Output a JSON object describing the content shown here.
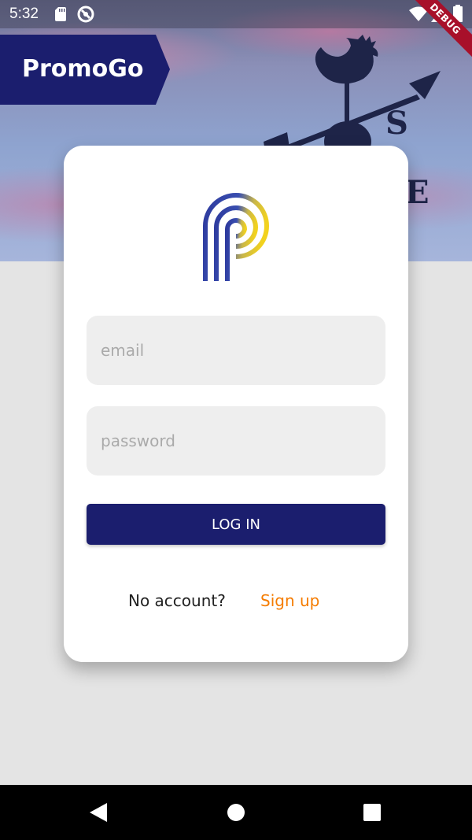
{
  "status_bar": {
    "time": "5:32",
    "debug_label": "DEBUG"
  },
  "brand": {
    "name": "PromoGo",
    "ribbon_color": "#1b1e6e"
  },
  "login": {
    "email_placeholder": "email",
    "password_placeholder": "password",
    "button_label": "LOG IN",
    "no_account_text": "No account?",
    "signup_label": "Sign up"
  },
  "colors": {
    "primary": "#1b1e6e",
    "accent": "#f57c00",
    "field_bg": "#eeeeee",
    "page_bg": "#e4e4e4"
  },
  "icons": {
    "status": [
      "sd-card-icon",
      "dnd-icon",
      "wifi-icon",
      "signal-icon",
      "battery-icon"
    ],
    "navigation": [
      "back-icon",
      "home-icon",
      "recents-icon"
    ]
  }
}
